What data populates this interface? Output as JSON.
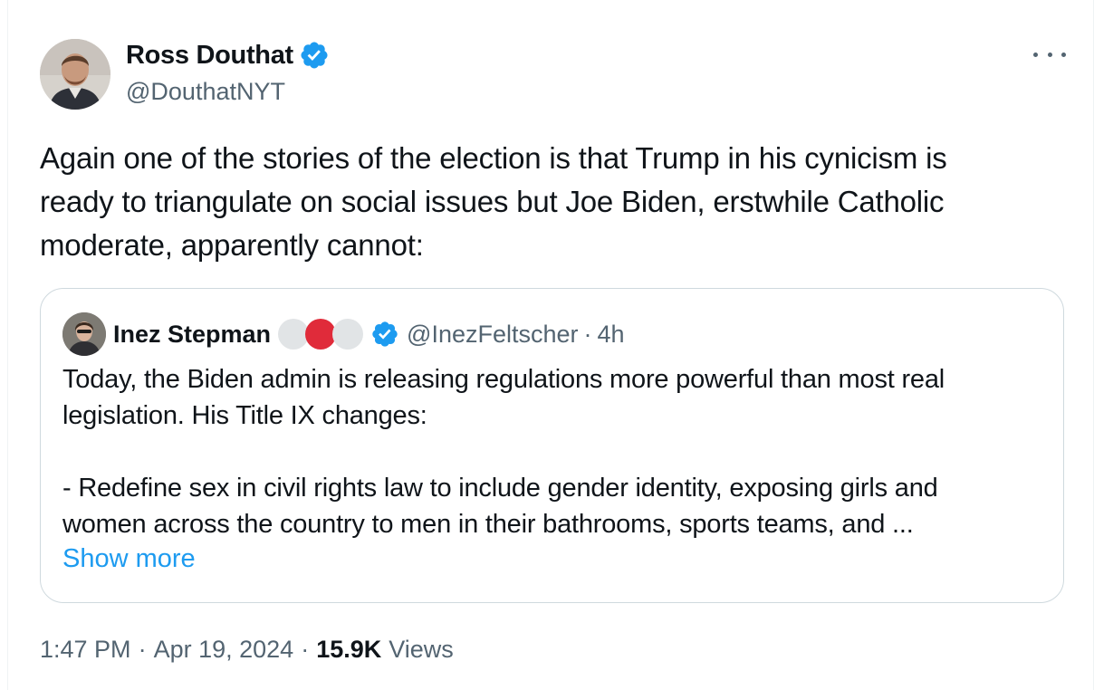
{
  "author": {
    "name": "Ross Douthat",
    "handle": "@DouthatNYT",
    "verified": true,
    "avatar": "person-avatar"
  },
  "tweet_text": "Again one of the stories of the election is that Trump in his cynicism is\nready to triangulate on social issues but Joe Biden, erstwhile Catholic\nmoderate, apparently cannot:",
  "quoted": {
    "name": "Inez Stepman",
    "emoji_dots": [
      "#e1e4e6",
      "#e02b3a",
      "#e1e4e6"
    ],
    "handle": "@InezFeltscher",
    "separator": "·",
    "time": "4h",
    "text": "Today, the Biden admin is releasing regulations more powerful than most real\nlegislation. His Title IX changes:\n\n- Redefine sex in civil rights law to include gender identity, exposing girls and\nwomen across the country to men in their bathrooms, sports teams, and ...",
    "show_more": "Show more"
  },
  "meta": {
    "time": "1:47 PM",
    "sep1": "·",
    "date": "Apr 19, 2024",
    "sep2": "·",
    "views_count": "15.9K",
    "views_label": "Views"
  },
  "colors": {
    "verified": "#1d9bf0",
    "link": "#1d9bf0",
    "secondary_text": "#536471",
    "border": "#cfd9de"
  }
}
